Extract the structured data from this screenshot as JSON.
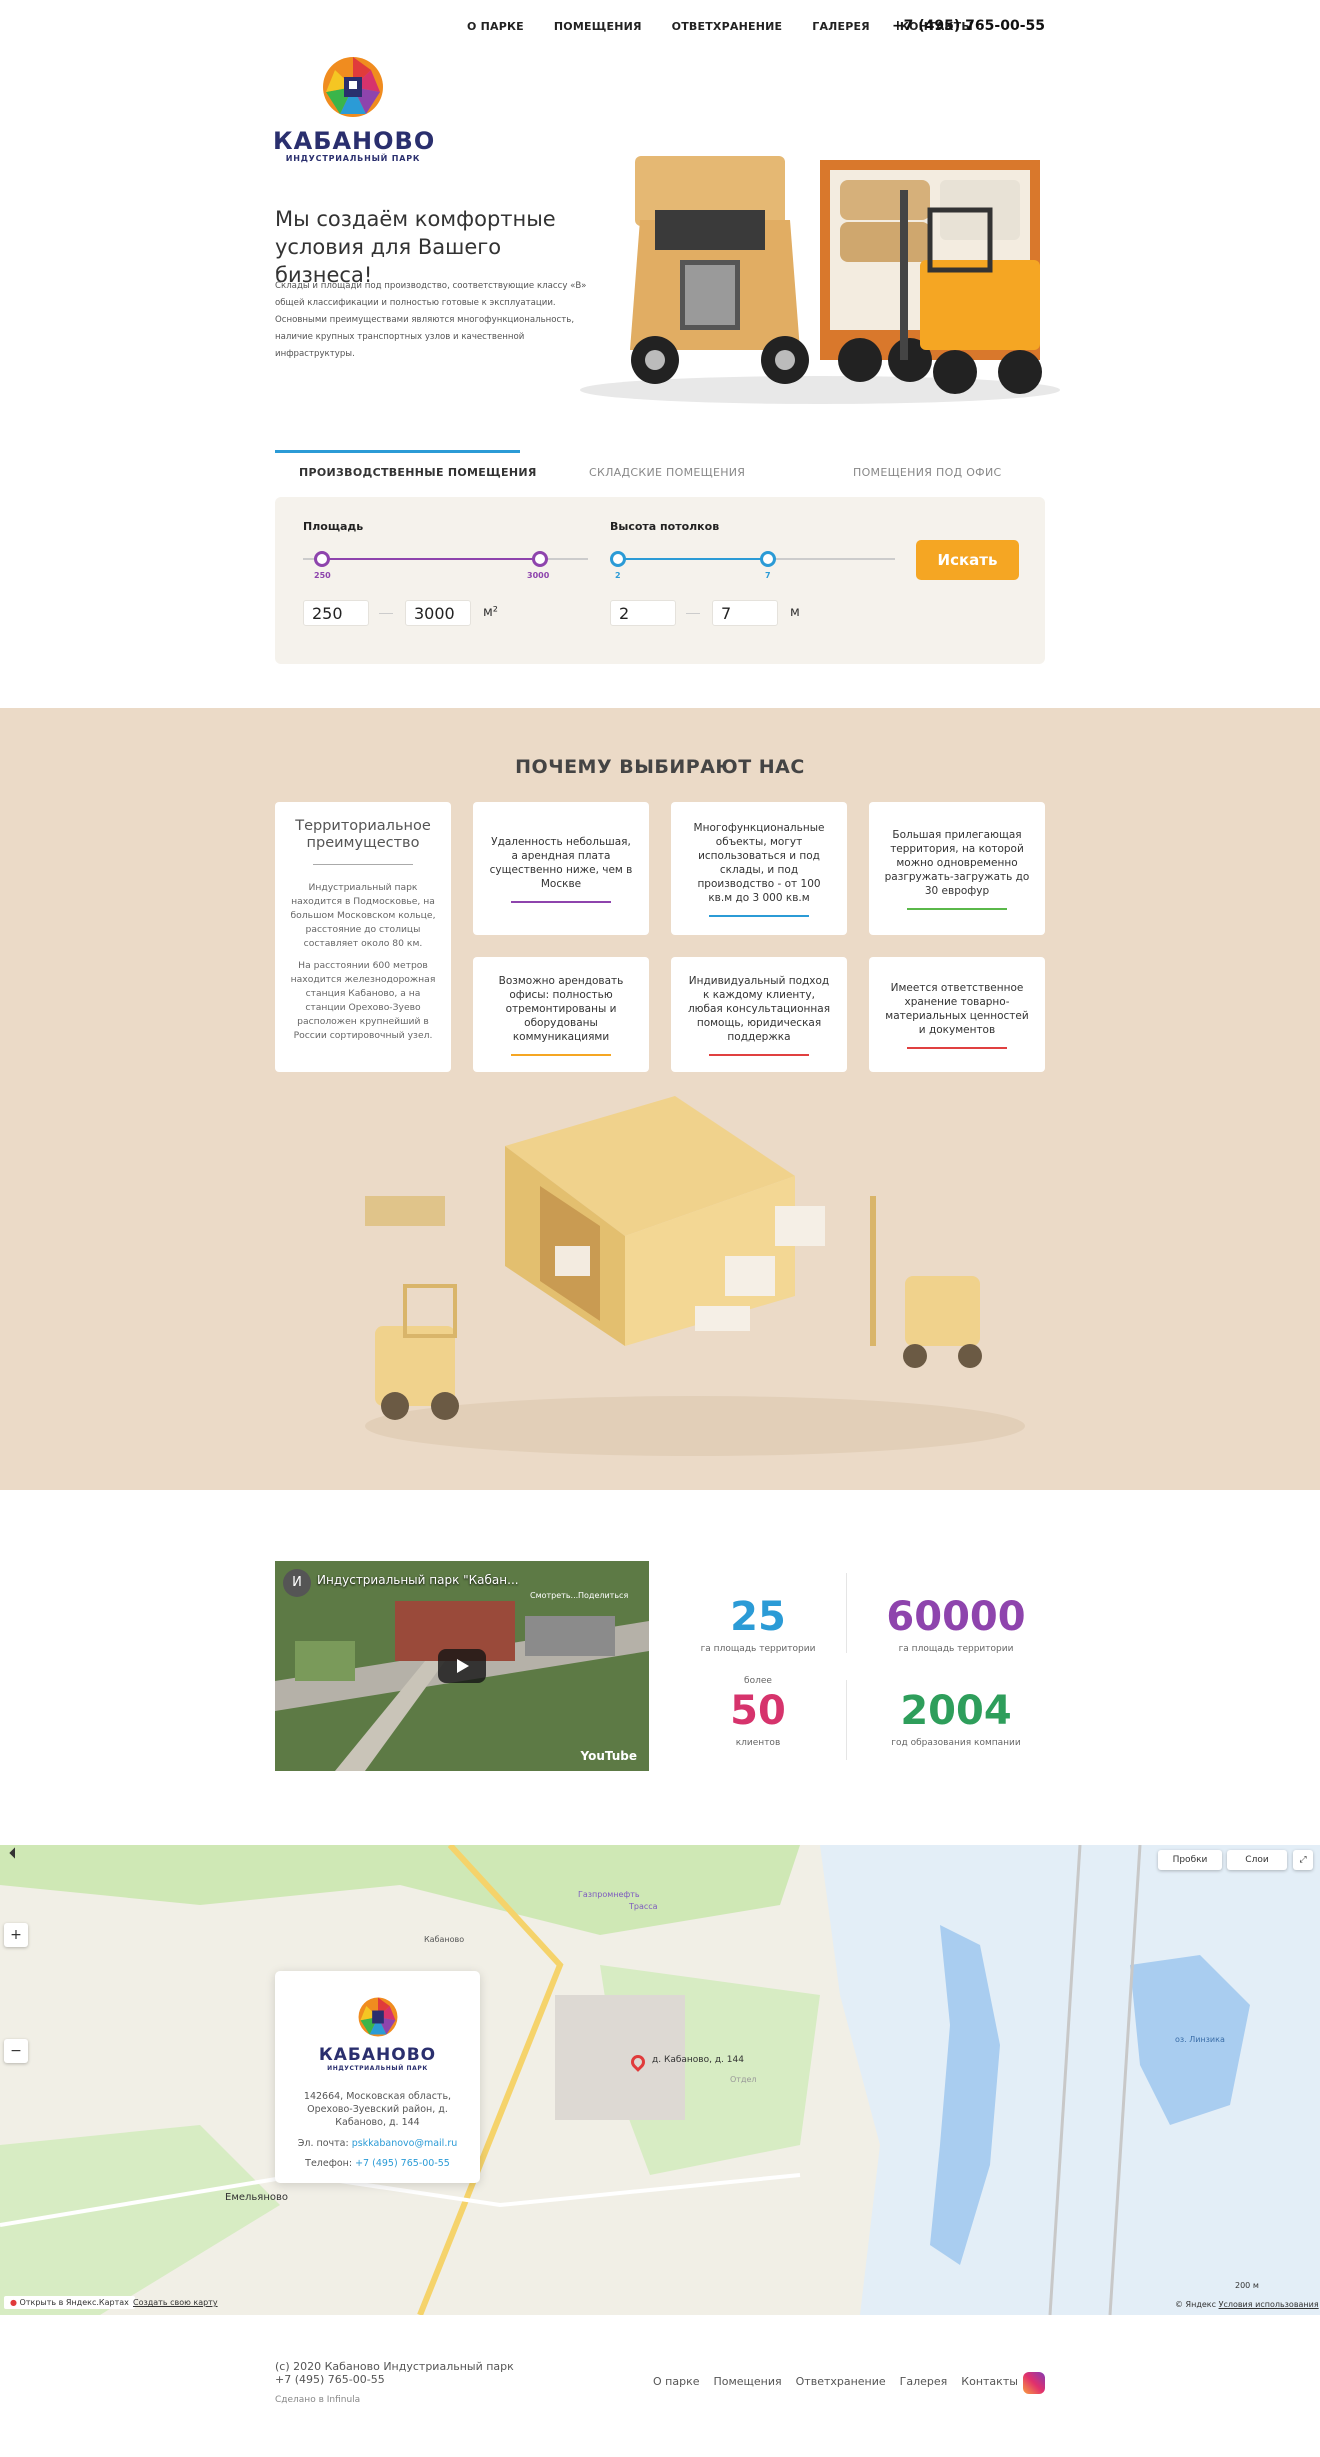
{
  "nav": {
    "links": [
      "О ПАРКЕ",
      "ПОМЕЩЕНИЯ",
      "ОТВЕТХРАНЕНИЕ",
      "ГАЛЕРЕЯ",
      "КОНТАКТЫ"
    ],
    "phone": "+7 (495) 765-00-55"
  },
  "logo": {
    "name": "КАБАНОВО",
    "subtitle": "ИНДУСТРИАЛЬНЫЙ ПАРК"
  },
  "hero": {
    "title": "Мы создаём комфортные условия для Вашего бизнеса!",
    "text": "Склады и площади под производство, соответствующие классу «B» общей классификации и полностью готовые к эксплуатации. Основными преимуществами являются многофункциональность, наличие крупных транспортных узлов и качественной инфраструктуры."
  },
  "tabs": [
    "ПРОИЗВОДСТВЕННЫЕ ПОМЕЩЕНИЯ",
    "СКЛАДСКИЕ ПОМЕЩЕНИЯ",
    "ПОМЕЩЕНИЯ ПОД ОФИС"
  ],
  "filter": {
    "area": {
      "label": "Площадь",
      "min": "250",
      "max": "3000",
      "unit": "м²",
      "from": "250",
      "to": "3000"
    },
    "height": {
      "label": "Высота потолков",
      "min": "2",
      "max": "7",
      "unit": "м",
      "from": "2",
      "to": "7"
    },
    "search_label": "Искать"
  },
  "why": {
    "title": "ПОЧЕМУ ВЫБИРАЮТ НАС",
    "card1": {
      "heading": "Территориальное преимущество",
      "p1": "Индустриальный парк находится в Подмосковье, на большом Московском кольце, расстояние до столицы составляет около 80 км.",
      "p2": "На расстоянии 600 метров находится железнодорожная станция Кабаново, а на станции Орехово-Зуево расположен крупнейший в России сортировочный узел."
    },
    "cards": [
      {
        "text": "Удаленность небольшая, а арендная плата существенно ниже, чем в Москве",
        "color": "#8e44ad"
      },
      {
        "text": "Многофункциональные объекты, могут использоваться и под склады, и под производство - от 100 кв.м до 3 000 кв.м",
        "color": "#2b9bd6"
      },
      {
        "text": "Большая прилегающая территория, на которой можно одновременно разгружать-загружать до 30 еврофур",
        "color": "#5ab84a"
      },
      {
        "text": "Возможно арендовать офисы: полностью отремонтированы и оборудованы коммуникациями",
        "color": "#f5a623"
      },
      {
        "text": "Индивидуальный подход к каждому клиенту, любая консультационная помощь, юридическая поддержка",
        "color": "#e04040"
      },
      {
        "text": "Имеется ответственное хранение товарно-материальных ценностей и документов",
        "color": "#e04040"
      }
    ]
  },
  "video": {
    "title": "Индустриальный парк \"Кабан...",
    "watch": "Смотреть...",
    "share": "Поделиться",
    "brand": "YouTube",
    "avatar": "И"
  },
  "stats": [
    {
      "pre": "",
      "value": "25",
      "label": "га площадь территории",
      "color": "#2b9bd6"
    },
    {
      "pre": "",
      "value": "60000",
      "label": "га площадь территории",
      "color": "#8e44ad"
    },
    {
      "pre": "более",
      "value": "50",
      "label": "клиентов",
      "color": "#d6336c"
    },
    {
      "pre": "",
      "value": "2004",
      "label": "год образования компании",
      "color": "#2e9e5b"
    }
  ],
  "map": {
    "address": "142664, Московская область, Орехово-Зуевский район, д. Кабаново, д. 144",
    "email_label": "Эл. почта:",
    "email": "pskkabanovo@mail.ru",
    "phone_label": "Телефон:",
    "phone": "+7 (495) 765-00-55",
    "marker": "д. Кабаново, д. 144",
    "traffic": "Пробки",
    "layers": "Слои",
    "open": "Открыть в Яндекс.Картах",
    "create": "Создать свою карту",
    "copyright": "© Яндекс",
    "terms": "Условия использования",
    "scale": "200 м",
    "places": [
      "Кабаново",
      "Емельяново",
      "Газпромнефть",
      "Трасса",
      "оз. Линзика",
      "Отдел"
    ]
  },
  "footer": {
    "copyright": "(с) 2020 Кабаново Индустриальный парк",
    "phone": "+7 (495) 765-00-55",
    "made": "Сделано в Infinula",
    "links": [
      "О парке",
      "Помещения",
      "Ответхранение",
      "Галерея",
      "Контакты"
    ]
  }
}
